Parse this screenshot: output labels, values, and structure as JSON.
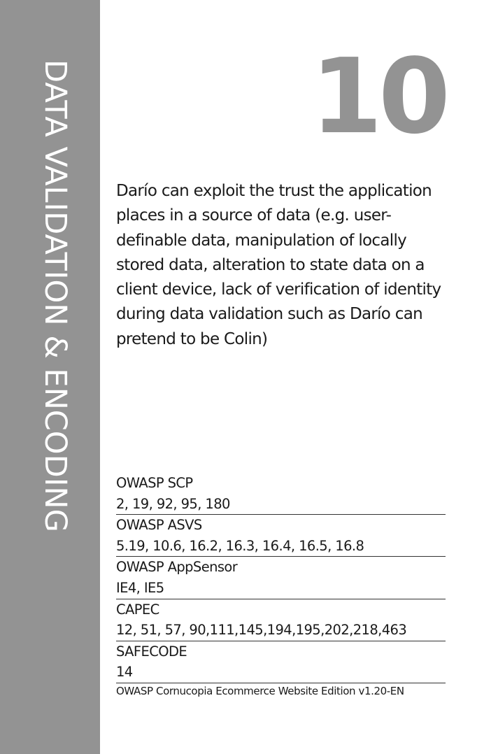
{
  "card": {
    "suit": "DATA VALIDATION & ENCODING",
    "number": "10",
    "description": "Darío can exploit the trust the application places in a source of data (e.g. user-definable data, manipulation of locally stored data, alteration to state data on a client device, lack of verification of identity during data validation such as Darío can pretend to be Colin)"
  },
  "references": [
    {
      "label": "OWASP SCP",
      "value": "2, 19, 92, 95, 180"
    },
    {
      "label": "OWASP ASVS",
      "value": "5.19, 10.6, 16.2, 16.3, 16.4, 16.5, 16.8"
    },
    {
      "label": "OWASP AppSensor",
      "value": "IE4, IE5"
    },
    {
      "label": "CAPEC",
      "value": "12, 51, 57, 90,111,145,194,195,202,218,463"
    },
    {
      "label": "SAFECODE",
      "value": "14"
    }
  ],
  "footer": "OWASP Cornucopia Ecommerce Website Edition v1.20-EN",
  "colors": {
    "sidebar": "#939393",
    "number": "#939393",
    "text": "#1a1a1a"
  }
}
